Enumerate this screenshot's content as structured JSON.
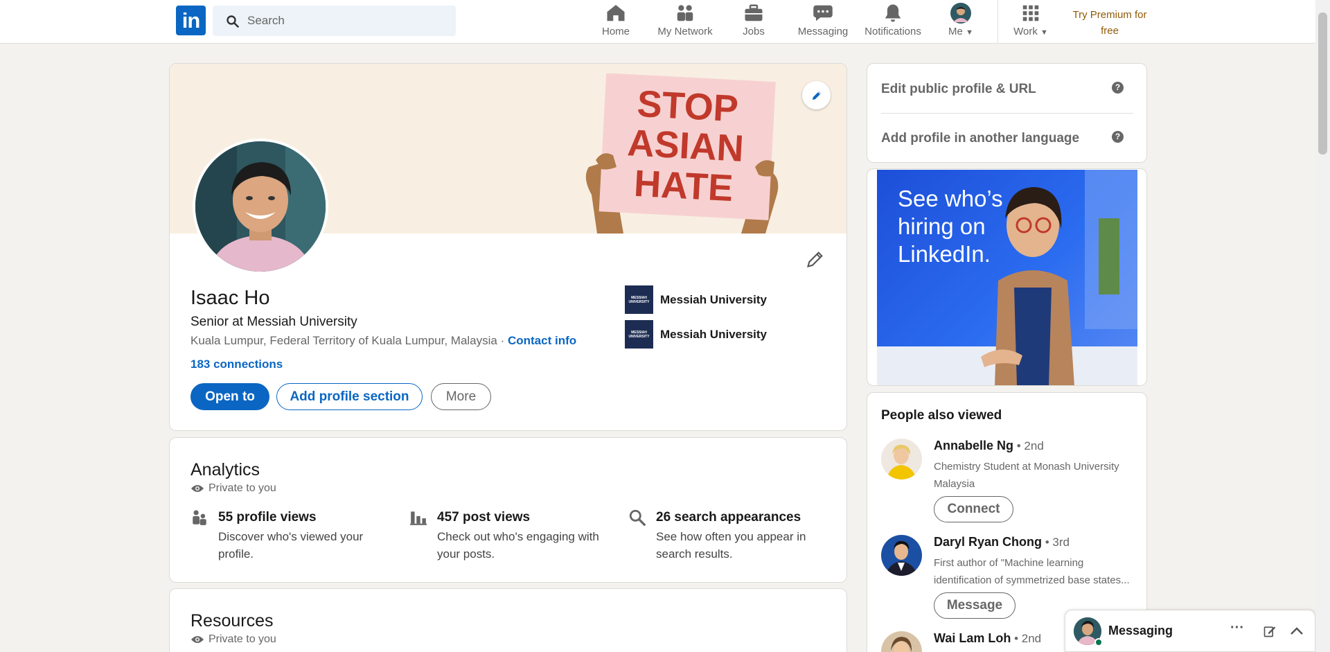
{
  "nav": {
    "logo_text": "in",
    "search_placeholder": "Search",
    "items": [
      {
        "label": "Home",
        "icon": "home-icon"
      },
      {
        "label": "My Network",
        "icon": "network-icon"
      },
      {
        "label": "Jobs",
        "icon": "briefcase-icon"
      },
      {
        "label": "Messaging",
        "icon": "chat-icon"
      },
      {
        "label": "Notifications",
        "icon": "bell-icon"
      },
      {
        "label": "Me",
        "icon": "avatar"
      },
      {
        "label": "Work",
        "icon": "grid-icon"
      }
    ],
    "premium_line1": "Try Premium for",
    "premium_line2": "free"
  },
  "profile": {
    "banner_sign": [
      "STOP",
      "ASIAN",
      "HATE"
    ],
    "name": "Isaac Ho",
    "headline": "Senior at Messiah University",
    "location": "Kuala Lumpur, Federal Territory of Kuala Lumpur, Malaysia",
    "separator": " · ",
    "contact_info": "Contact info",
    "connections": "183 connections",
    "buttons": {
      "open_to": "Open to",
      "add_section": "Add profile section",
      "more": "More"
    },
    "education": [
      {
        "name": "Messiah University",
        "logo_text": "MESSIAH UNIVERSITY"
      },
      {
        "name": "Messiah University",
        "logo_text": "MESSIAH UNIVERSITY"
      }
    ]
  },
  "analytics": {
    "title": "Analytics",
    "private": "Private to you",
    "stats": [
      {
        "value": "55 profile views",
        "desc": "Discover who's viewed your profile."
      },
      {
        "value": "457 post views",
        "desc": "Check out who's engaging with your posts."
      },
      {
        "value": "26 search appearances",
        "desc": "See how often you appear in search results."
      }
    ]
  },
  "resources": {
    "title": "Resources",
    "private": "Private to you"
  },
  "sidebar": {
    "edit_public_profile": "Edit public profile & URL",
    "add_language": "Add profile in another language",
    "help": "?"
  },
  "ad": {
    "line1": "See who’s",
    "line2": "hiring on",
    "line3": "LinkedIn."
  },
  "people_also_viewed": {
    "title": "People also viewed",
    "people": [
      {
        "name": "Annabelle Ng",
        "degree": " • 2nd",
        "desc": "Chemistry Student at Monash University Malaysia",
        "action": "Connect"
      },
      {
        "name": "Daryl Ryan Chong",
        "degree": " • 3rd",
        "desc": "First author of \"Machine learning identification of symmetrized base states...",
        "action": "Message"
      },
      {
        "name": "Wai Lam Loh",
        "degree": " • 2nd",
        "desc": "",
        "action": ""
      }
    ]
  },
  "messaging": {
    "label": "Messaging",
    "more": "···"
  },
  "colors": {
    "brand": "#0a66c2",
    "premium": "#915907",
    "page_bg": "#f4f2ee",
    "banner_bg": "#f8efe2",
    "sign_text": "#c0392b",
    "online": "#01754f"
  }
}
